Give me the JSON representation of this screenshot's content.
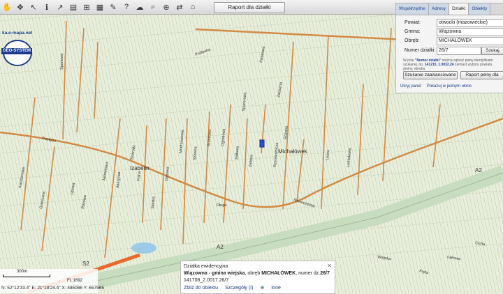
{
  "toolbar": {
    "tools": [
      "hand-icon",
      "pan-icon",
      "arrow-icon",
      "info-icon",
      "measure-icon",
      "print-icon",
      "grid-icon",
      "layers-icon",
      "edit-icon",
      "help-icon",
      "weather-icon",
      "search-icon",
      "zoom-icon",
      "share-icon",
      "building-icon"
    ],
    "report_button": "Raport dla działki"
  },
  "logo": {
    "site": "ka.e-mapa.net",
    "brand": "GEO-SYSTEM"
  },
  "panel": {
    "tabs": [
      "Współrzędne",
      "Adresy",
      "Działki",
      "Obiekty"
    ],
    "active_tab": "Działki",
    "powiat_label": "Powiat:",
    "powiat_value": "otwocki (mazowieckie)",
    "gmina_label": "Gmina:",
    "gmina_value": "Wiązowna",
    "obreb_label": "Obręb:",
    "obreb_value": "MICHAŁÓWEK",
    "numer_label": "Numer działki:",
    "numer_value": "26/7",
    "search_button": "Szukaj",
    "hint_pre": "W pole",
    "hint_bold": "\"Numer działki\"",
    "hint_rest": "można wpisać pełny identyfikator szukanej, np.",
    "hint_example": "141215_1.0032.24",
    "hint_end": "zamiast wyboru powiatu, gminy, obrębu.",
    "advanced_button": "Szukanie zaawansowane",
    "report_button": "Raport pełny dla",
    "hide_link": "Ukryj panel",
    "show_link": "Pokazuj w jednym oknie"
  },
  "popup": {
    "title": "Działka ewidencyjna",
    "line1_pre": "Wiązowna - gmina wiejska",
    "line1_mid": ", obręb ",
    "line1_obreb": "MICHAŁÓWEK",
    "line1_num_pre": ", numer dz.",
    "line1_num": "26/7",
    "line2": "141708_2.0017.26/7",
    "zoom_link": "Zbliż do obiektu",
    "details_link": "Szczegóły (I)",
    "other_link": "Inne"
  },
  "scale": {
    "distance": "300m",
    "ratio": "FL:1692",
    "coords": "N: 52°12'33.4\"  E: 21°18'24.4\"   X: 485086   Y: 657565"
  },
  "map_labels": {
    "village": "Michałówek",
    "village2": "Izabelin",
    "road_a2": "A2",
    "road_s2": "S2",
    "streets": [
      "Postępu",
      "Nowoczesna",
      "Długa",
      "Sportowa",
      "Podleśna",
      "Kwiatowa",
      "Zaciszna",
      "Spacerowa",
      "Lipowa",
      "Polna",
      "Sielska",
      "Dębowa",
      "Modrzewiowa",
      "Szkolna",
      "Brzozowa",
      "Ogrodowa",
      "Jodłowa",
      "Zielona",
      "Rzemieślnicza",
      "Różana",
      "Jaśminowa",
      "Akacjowa",
      "Stokrotki",
      "Różowa",
      "Graniczna",
      "Kasztanowa",
      "Leśna",
      "Letniskowa",
      "Wiejska",
      "Kręta",
      "Łąkowa",
      "Cicha"
    ]
  },
  "colors": {
    "accent": "#1a3c8c",
    "road_main": "#d38a44",
    "road_a2": "#c5dcc0",
    "parcel": "#2c53d6"
  }
}
